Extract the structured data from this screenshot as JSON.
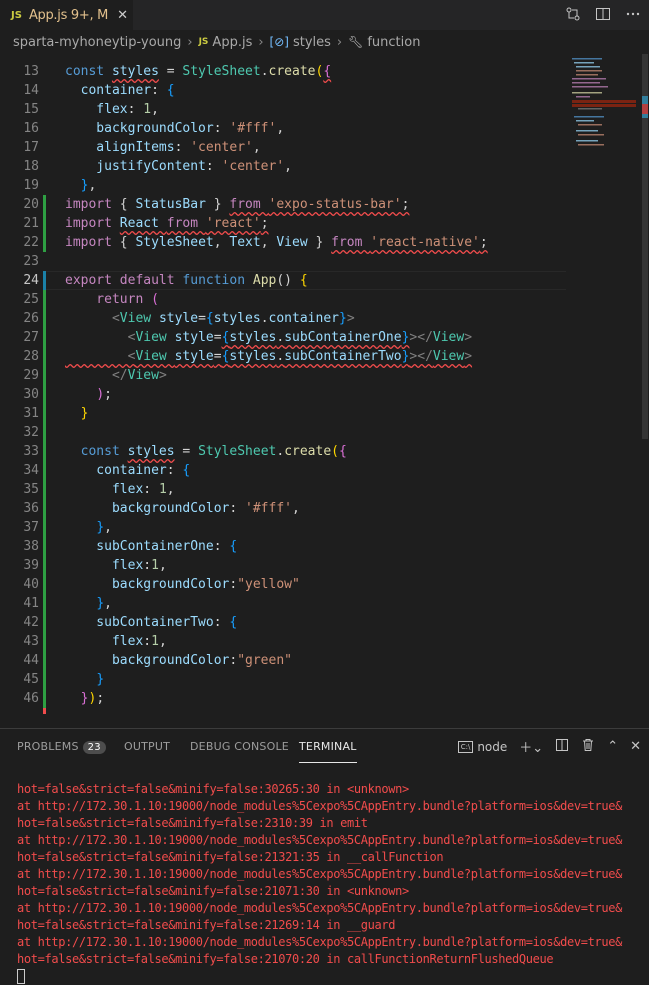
{
  "tab": {
    "icon": "JS",
    "name": "App.js",
    "status": "9+, M",
    "close": "✕"
  },
  "breadcrumb": {
    "folder": "sparta-myhoneytip-young",
    "file": "App.js",
    "symbol1": "styles",
    "symbol2": "function",
    "file_icon": "JS"
  },
  "colors": {
    "keyword": "#569cd6",
    "control": "#c586c0",
    "variable": "#9cdcfe",
    "class": "#4ec9b0",
    "function": "#dcdcaa",
    "string": "#ce9178",
    "number": "#b5cea8",
    "plain": "#d4d4d4",
    "bracket1": "#ffd700",
    "bracket2": "#da70d6",
    "bracket3": "#179fff",
    "tag": "#808080"
  },
  "code_lines": [
    {
      "n": 13,
      "t": [
        [
          "const ",
          "keyword"
        ],
        [
          "styles",
          "variable",
          "sq"
        ],
        [
          " = ",
          "plain"
        ],
        [
          "StyleSheet",
          "class"
        ],
        [
          ".",
          "plain"
        ],
        [
          "create",
          "function"
        ],
        [
          "(",
          "bracket1"
        ],
        [
          "{",
          "bracket2",
          "sq"
        ]
      ]
    },
    {
      "n": 14,
      "t": [
        [
          "  container",
          "variable"
        ],
        [
          ": ",
          "plain"
        ],
        [
          "{",
          "bracket3"
        ]
      ]
    },
    {
      "n": 15,
      "t": [
        [
          "    flex",
          "variable"
        ],
        [
          ": ",
          "plain"
        ],
        [
          "1",
          "number"
        ],
        [
          ",",
          "plain"
        ]
      ]
    },
    {
      "n": 16,
      "t": [
        [
          "    backgroundColor",
          "variable"
        ],
        [
          ": ",
          "plain"
        ],
        [
          "'#fff'",
          "string"
        ],
        [
          ",",
          "plain"
        ]
      ]
    },
    {
      "n": 17,
      "t": [
        [
          "    alignItems",
          "variable"
        ],
        [
          ": ",
          "plain"
        ],
        [
          "'center'",
          "string"
        ],
        [
          ",",
          "plain"
        ]
      ]
    },
    {
      "n": 18,
      "t": [
        [
          "    justifyContent",
          "variable"
        ],
        [
          ": ",
          "plain"
        ],
        [
          "'center'",
          "string"
        ],
        [
          ",",
          "plain"
        ]
      ]
    },
    {
      "n": 19,
      "t": [
        [
          "  ",
          "plain"
        ],
        [
          "}",
          "bracket3"
        ],
        [
          ",",
          "plain"
        ]
      ]
    },
    {
      "n": 20,
      "t": [
        [
          "import ",
          "control"
        ],
        [
          "{ ",
          "plain"
        ],
        [
          "StatusBar",
          "variable"
        ],
        [
          " } ",
          "plain"
        ],
        [
          "from ",
          "control",
          "sq"
        ],
        [
          "'expo-status-bar'",
          "string",
          "sq"
        ],
        [
          ";",
          "plain",
          "sq"
        ]
      ]
    },
    {
      "n": 21,
      "t": [
        [
          "import ",
          "control"
        ],
        [
          "React ",
          "variable",
          "sq"
        ],
        [
          "from ",
          "control",
          "sq"
        ],
        [
          "'react'",
          "string",
          "sq"
        ],
        [
          ";",
          "plain",
          "sq"
        ]
      ]
    },
    {
      "n": 22,
      "t": [
        [
          "import ",
          "control"
        ],
        [
          "{ ",
          "plain"
        ],
        [
          "StyleSheet",
          "variable"
        ],
        [
          ", ",
          "plain"
        ],
        [
          "Text",
          "variable"
        ],
        [
          ", ",
          "plain"
        ],
        [
          "View",
          "variable"
        ],
        [
          " } ",
          "plain"
        ],
        [
          "from ",
          "control",
          "sq"
        ],
        [
          "'react-native'",
          "string",
          "sq"
        ],
        [
          ";",
          "plain",
          "sq"
        ]
      ]
    },
    {
      "n": 23,
      "t": []
    },
    {
      "n": 24,
      "t": [
        [
          "export ",
          "control"
        ],
        [
          "default ",
          "control"
        ],
        [
          "function ",
          "keyword"
        ],
        [
          "App",
          "function"
        ],
        [
          "() ",
          "plain"
        ],
        [
          "{",
          "bracket1"
        ]
      ]
    },
    {
      "n": 25,
      "t": [
        [
          "    return ",
          "control"
        ],
        [
          "(",
          "bracket2"
        ]
      ]
    },
    {
      "n": 26,
      "t": [
        [
          "      <",
          "tag"
        ],
        [
          "View ",
          "class"
        ],
        [
          "style",
          "variable"
        ],
        [
          "=",
          "plain"
        ],
        [
          "{",
          "bracket3"
        ],
        [
          "styles",
          "variable"
        ],
        [
          ".",
          "plain"
        ],
        [
          "container",
          "variable"
        ],
        [
          "}",
          "bracket3"
        ],
        [
          ">",
          "tag"
        ]
      ]
    },
    {
      "n": 27,
      "t": [
        [
          "        <",
          "tag"
        ],
        [
          "View ",
          "class"
        ],
        [
          "style",
          "variable"
        ],
        [
          "=",
          "plain"
        ],
        [
          "{",
          "bracket3",
          "sq"
        ],
        [
          "styles",
          "variable",
          "sq"
        ],
        [
          ".",
          "plain",
          "sq"
        ],
        [
          "subContainerOne",
          "variable",
          "sq"
        ],
        [
          "}",
          "bracket3",
          "sq"
        ],
        [
          "></",
          "tag"
        ],
        [
          "View",
          "class"
        ],
        [
          ">",
          "tag"
        ]
      ]
    },
    {
      "n": 28,
      "t": [
        [
          "        <",
          "tag",
          "sq"
        ],
        [
          "View ",
          "class",
          "sq"
        ],
        [
          "style",
          "variable",
          "sq"
        ],
        [
          "=",
          "plain",
          "sq"
        ],
        [
          "{",
          "bracket3",
          "sq"
        ],
        [
          "styles",
          "variable",
          "sq"
        ],
        [
          ".",
          "plain",
          "sq"
        ],
        [
          "subContainerTwo",
          "variable",
          "sq"
        ],
        [
          "}",
          "bracket3",
          "sq"
        ],
        [
          "></",
          "tag",
          "sq"
        ],
        [
          "View",
          "class",
          "sq"
        ],
        [
          ">",
          "tag",
          "sq"
        ]
      ]
    },
    {
      "n": 29,
      "t": [
        [
          "      </",
          "tag"
        ],
        [
          "View",
          "class"
        ],
        [
          ">",
          "tag"
        ]
      ]
    },
    {
      "n": 30,
      "t": [
        [
          "    ",
          "plain"
        ],
        [
          ")",
          "bracket2"
        ],
        [
          ";",
          "plain"
        ]
      ]
    },
    {
      "n": 31,
      "t": [
        [
          "  ",
          "plain"
        ],
        [
          "}",
          "bracket1"
        ]
      ]
    },
    {
      "n": 32,
      "t": []
    },
    {
      "n": 33,
      "t": [
        [
          "  const ",
          "keyword"
        ],
        [
          "styles",
          "variable",
          "sq"
        ],
        [
          " = ",
          "plain"
        ],
        [
          "StyleSheet",
          "class"
        ],
        [
          ".",
          "plain"
        ],
        [
          "create",
          "function"
        ],
        [
          "(",
          "bracket1"
        ],
        [
          "{",
          "bracket2"
        ]
      ]
    },
    {
      "n": 34,
      "t": [
        [
          "    container",
          "variable"
        ],
        [
          ": ",
          "plain"
        ],
        [
          "{",
          "bracket3"
        ]
      ]
    },
    {
      "n": 35,
      "t": [
        [
          "      flex",
          "variable"
        ],
        [
          ": ",
          "plain"
        ],
        [
          "1",
          "number"
        ],
        [
          ",",
          "plain"
        ]
      ]
    },
    {
      "n": 36,
      "t": [
        [
          "      backgroundColor",
          "variable"
        ],
        [
          ": ",
          "plain"
        ],
        [
          "'#fff'",
          "string"
        ],
        [
          ",",
          "plain"
        ]
      ]
    },
    {
      "n": 37,
      "t": [
        [
          "    ",
          "plain"
        ],
        [
          "}",
          "bracket3"
        ],
        [
          ",",
          "plain"
        ]
      ]
    },
    {
      "n": 38,
      "t": [
        [
          "    subContainerOne",
          "variable"
        ],
        [
          ": ",
          "plain"
        ],
        [
          "{",
          "bracket3"
        ]
      ]
    },
    {
      "n": 39,
      "t": [
        [
          "      flex",
          "variable"
        ],
        [
          ":",
          "plain"
        ],
        [
          "1",
          "number"
        ],
        [
          ",",
          "plain"
        ]
      ]
    },
    {
      "n": 40,
      "t": [
        [
          "      backgroundColor",
          "variable"
        ],
        [
          ":",
          "plain"
        ],
        [
          "\"yellow\"",
          "string"
        ]
      ]
    },
    {
      "n": 41,
      "t": [
        [
          "    ",
          "plain"
        ],
        [
          "}",
          "bracket3"
        ],
        [
          ",",
          "plain"
        ]
      ]
    },
    {
      "n": 42,
      "t": [
        [
          "    subContainerTwo",
          "variable"
        ],
        [
          ": ",
          "plain"
        ],
        [
          "{",
          "bracket3"
        ]
      ]
    },
    {
      "n": 43,
      "t": [
        [
          "      flex",
          "variable"
        ],
        [
          ":",
          "plain"
        ],
        [
          "1",
          "number"
        ],
        [
          ",",
          "plain"
        ]
      ]
    },
    {
      "n": 44,
      "t": [
        [
          "      backgroundColor",
          "variable"
        ],
        [
          ":",
          "plain"
        ],
        [
          "\"green\"",
          "string"
        ]
      ]
    },
    {
      "n": 45,
      "t": [
        [
          "    ",
          "plain"
        ],
        [
          "}",
          "bracket3"
        ]
      ]
    },
    {
      "n": 46,
      "t": [
        [
          "  ",
          "plain"
        ],
        [
          "}",
          "bracket2"
        ],
        [
          ")",
          "bracket1"
        ],
        [
          ";",
          "plain"
        ]
      ]
    }
  ],
  "active_line": 24,
  "panel": {
    "tabs": [
      {
        "label": "PROBLEMS",
        "badge": "23"
      },
      {
        "label": "OUTPUT"
      },
      {
        "label": "DEBUG CONSOLE"
      },
      {
        "label": "TERMINAL"
      }
    ],
    "shell": "node"
  },
  "terminal_lines": [
    "hot=false&strict=false&minify=false:30265:30 in <unknown>",
    "at http://172.30.1.10:19000/node_modules%5Cexpo%5CAppEntry.bundle?platform=ios&dev=true&",
    "hot=false&strict=false&minify=false:2310:39 in emit",
    "at http://172.30.1.10:19000/node_modules%5Cexpo%5CAppEntry.bundle?platform=ios&dev=true&",
    "hot=false&strict=false&minify=false:21321:35 in __callFunction",
    "at http://172.30.1.10:19000/node_modules%5Cexpo%5CAppEntry.bundle?platform=ios&dev=true&",
    "hot=false&strict=false&minify=false:21071:30 in <unknown>",
    "at http://172.30.1.10:19000/node_modules%5Cexpo%5CAppEntry.bundle?platform=ios&dev=true&",
    "hot=false&strict=false&minify=false:21269:14 in __guard",
    "at http://172.30.1.10:19000/node_modules%5Cexpo%5CAppEntry.bundle?platform=ios&dev=true&",
    "hot=false&strict=false&minify=false:21070:20 in callFunctionReturnFlushedQueue"
  ]
}
